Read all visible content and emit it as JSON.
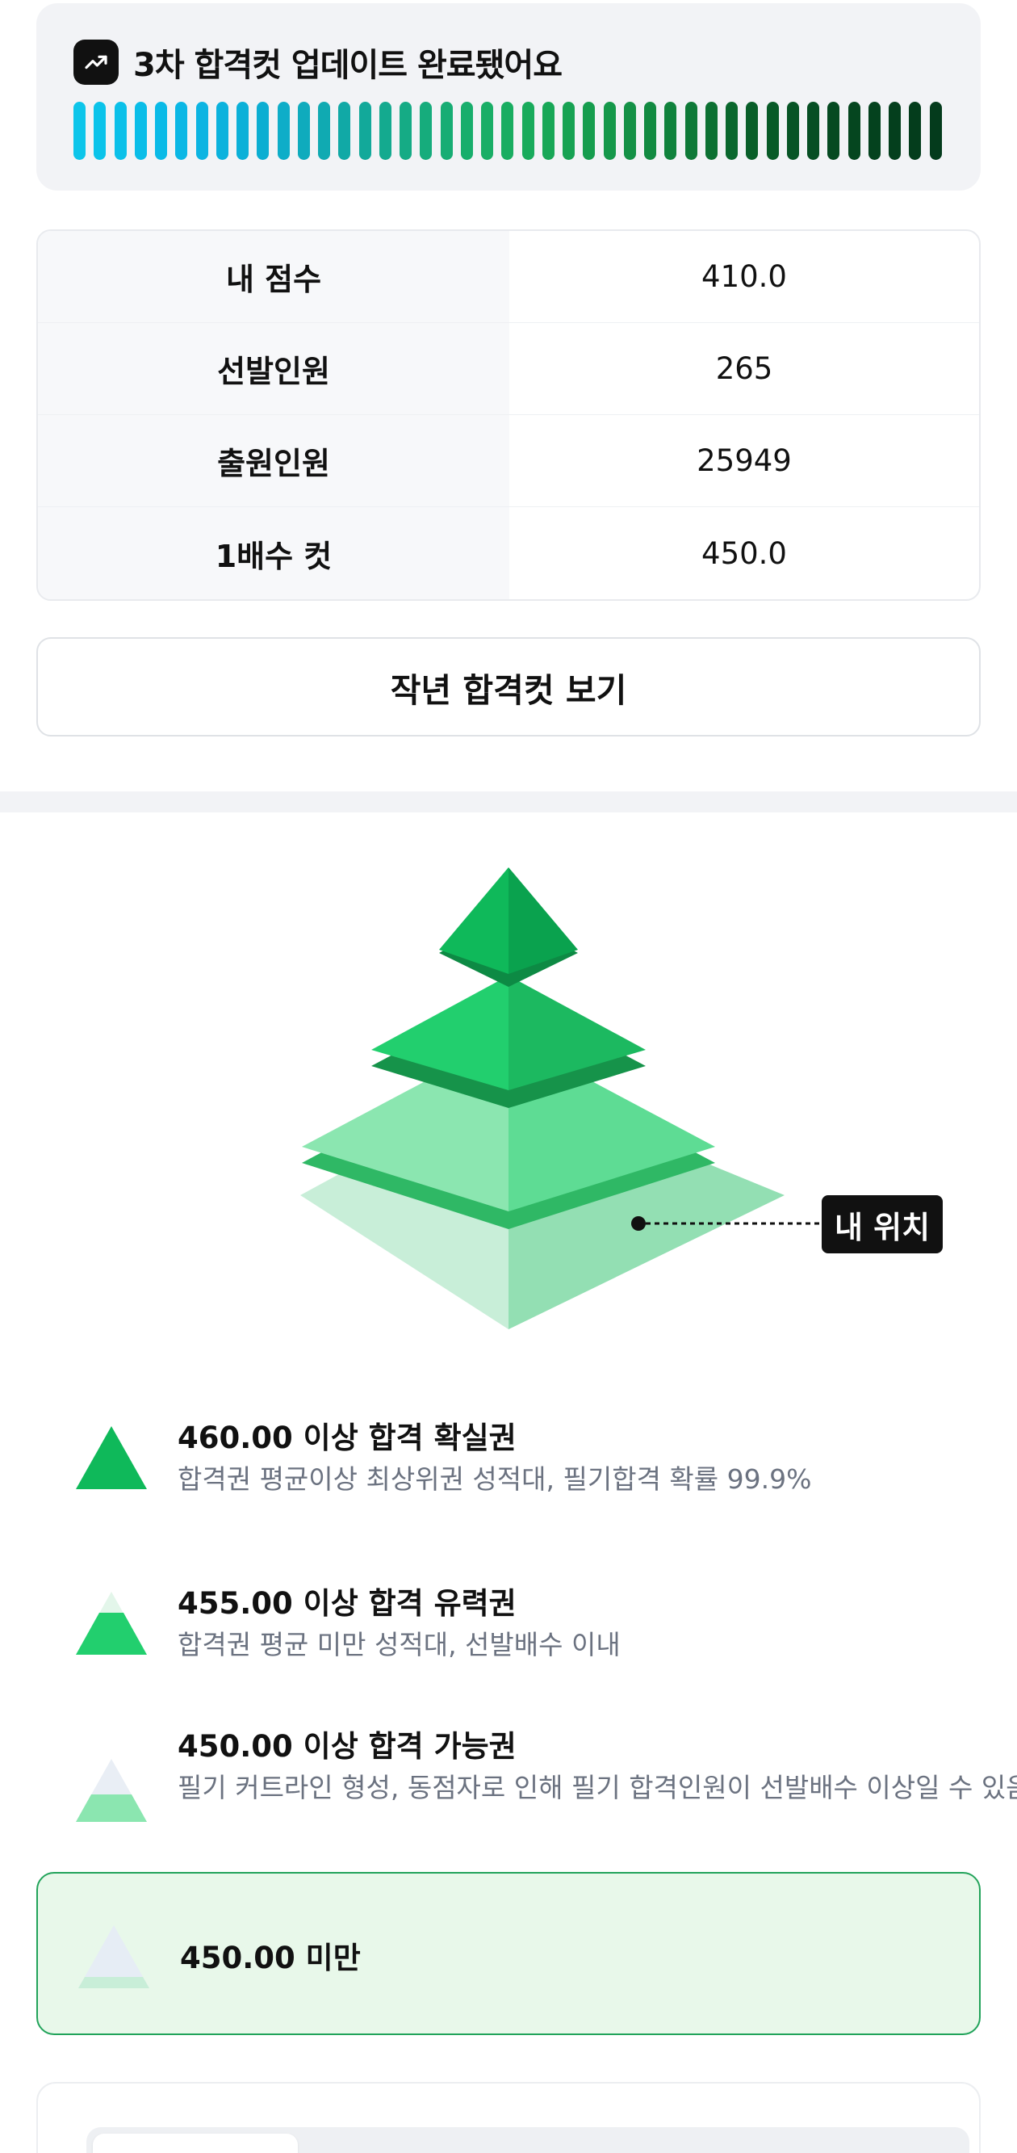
{
  "banner": {
    "title": "3차 합격컷 업데이트 완료됐어요",
    "icon": "trending-up-icon",
    "bar_colors": [
      "#0dc5ea",
      "#0bc3ea",
      "#0bc0e9",
      "#0abde8",
      "#0abae7",
      "#0bb7e5",
      "#0cb4e2",
      "#0bb2dd",
      "#0bb0d8",
      "#0caed2",
      "#0eadc8",
      "#0fabbd",
      "#10aab2",
      "#11a9a6",
      "#12a99a",
      "#14aa8f",
      "#15ab85",
      "#16ac7c",
      "#17ad74",
      "#18ae6c",
      "#19ae66",
      "#19ad61",
      "#19ab5c",
      "#18a757",
      "#17a253",
      "#169d4e",
      "#15984a",
      "#149146",
      "#128a41",
      "#10823c",
      "#0e7937",
      "#0c7032",
      "#0a672d",
      "#095e29",
      "#085a27",
      "#075425",
      "#064e23",
      "#054a21",
      "#05461f",
      "#04421e",
      "#043f1d",
      "#043d1c",
      "#043b1c"
    ]
  },
  "info": {
    "rows": [
      {
        "label": "내 점수",
        "value": "410.0"
      },
      {
        "label": "선발인원",
        "value": "265"
      },
      {
        "label": "출원인원",
        "value": "25949"
      },
      {
        "label": "1배수 컷",
        "value": "450.0"
      }
    ]
  },
  "last_year_button": "작년 합격컷 보기",
  "pyramid": {
    "my_position_label": "내 위치",
    "colors": {
      "tier1": "#0fb95a",
      "tier2": "#22cf6e",
      "tier3": "#8be6b0",
      "tier4": "#c8eed8"
    }
  },
  "legend": [
    {
      "title": "460.00 이상 합격 확실권",
      "desc": "합격권 평균이상 최상위권 성적대, 필기합격 확률 99.9%"
    },
    {
      "title": "455.00 이상 합격 유력권",
      "desc": "합격권 평균 미만 성적대, 선발배수 이내"
    },
    {
      "title": "450.00 이상 합격 가능권",
      "desc": "필기 커트라인 형성, 동점자로 인해 필기 합격인원이 선발배수 이상일 수 있음"
    },
    {
      "title": "450.00 미만",
      "desc": ""
    }
  ]
}
